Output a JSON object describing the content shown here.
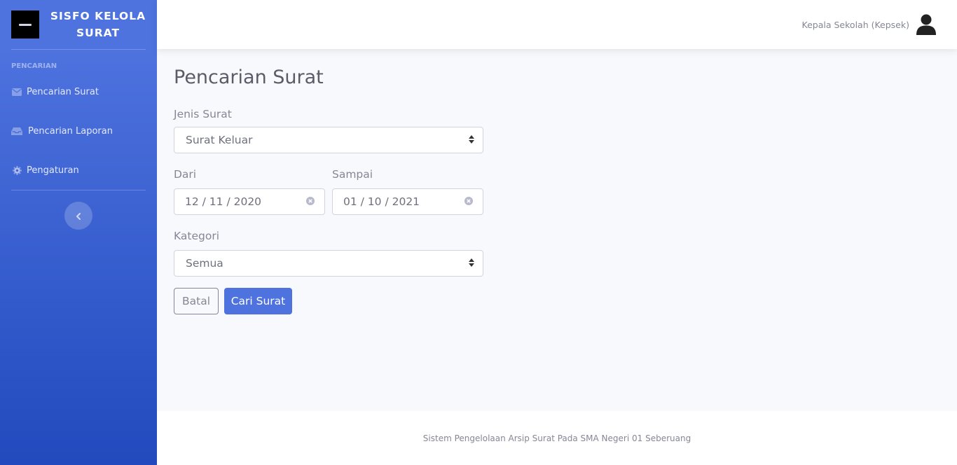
{
  "app": {
    "brand_line1": "SISFO KELOLA",
    "brand_line2": "SURAT"
  },
  "sidebar": {
    "heading": "PENCARIAN",
    "items": [
      {
        "label": "Pencarian Surat",
        "icon": "envelope-icon"
      },
      {
        "label": "Pencarian Laporan",
        "icon": "inbox-icon"
      },
      {
        "label": "Pengaturan",
        "icon": "gear-icon"
      }
    ],
    "toggle_icon": "chevron-left-icon"
  },
  "topbar": {
    "user_name": "Kepala Sekolah (Kepsek)",
    "avatar_icon": "user-icon"
  },
  "main": {
    "title": "Pencarian Surat",
    "jenis_label": "Jenis Surat",
    "jenis_value": "Surat Keluar",
    "dari_label": "Dari",
    "dari_value": "12 / 11 / 2020",
    "sampai_label": "Sampai",
    "sampai_value": "01 / 10 / 2021",
    "kategori_label": "Kategori",
    "kategori_value": "Semua",
    "cancel_label": "Batal",
    "search_label": "Cari Surat"
  },
  "footer": {
    "text": "Sistem Pengelolaan Arsip Surat Pada SMA Negeri 01 Seberuang"
  },
  "colors": {
    "primary": "#4e73df",
    "sidebar_gradient_end": "#224abe",
    "text_muted": "#858796"
  }
}
